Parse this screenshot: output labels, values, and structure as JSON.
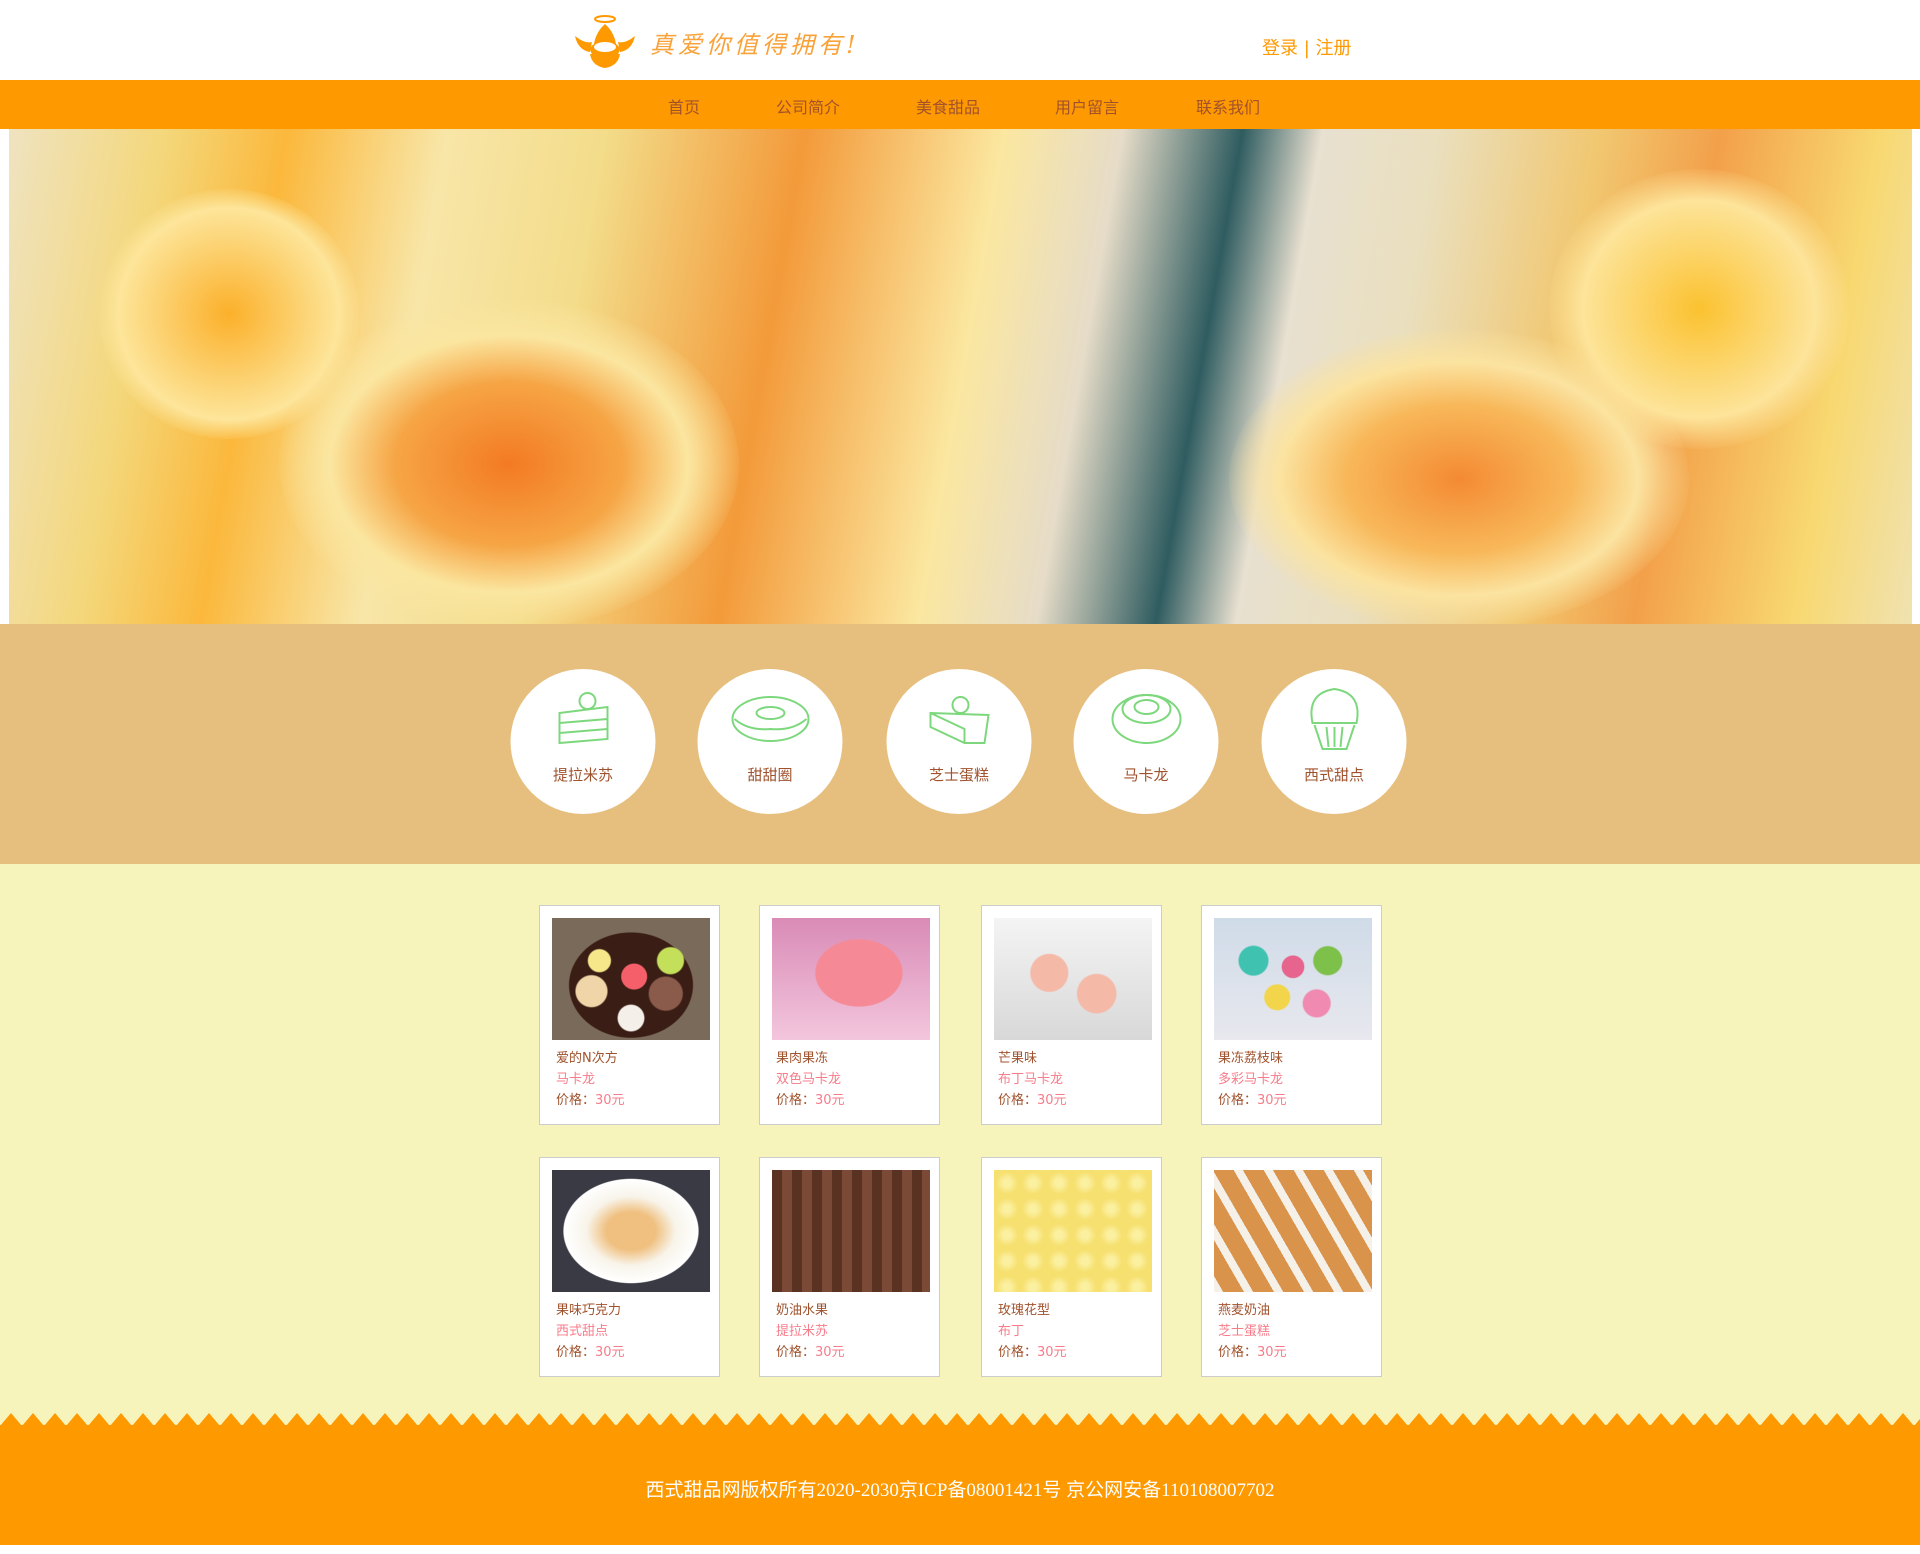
{
  "header": {
    "logo_text": "真爱你值得拥有!",
    "login": "登录",
    "separator": "|",
    "register": "注册"
  },
  "nav": [
    {
      "label": "首页"
    },
    {
      "label": "公司简介"
    },
    {
      "label": "美食甜品"
    },
    {
      "label": "用户留言"
    },
    {
      "label": "联系我们"
    }
  ],
  "categories": [
    {
      "label": "提拉米苏",
      "icon": "cake-slice-icon"
    },
    {
      "label": "甜甜圈",
      "icon": "donut-icon"
    },
    {
      "label": "芝士蛋糕",
      "icon": "cheesecake-icon"
    },
    {
      "label": "马卡龙",
      "icon": "macaron-icon"
    },
    {
      "label": "西式甜点",
      "icon": "cupcake-icon"
    }
  ],
  "price_label": "价格：",
  "products": [
    {
      "name": "爱的N次方",
      "category": "马卡龙",
      "price": "30元"
    },
    {
      "name": "果肉果冻",
      "category": "双色马卡龙",
      "price": "30元"
    },
    {
      "name": "芒果味",
      "category": "布丁马卡龙",
      "price": "30元"
    },
    {
      "name": "果冻荔枝味",
      "category": "多彩马卡龙",
      "price": "30元"
    },
    {
      "name": "果味巧克力",
      "category": "西式甜点",
      "price": "30元"
    },
    {
      "name": "奶油水果",
      "category": "提拉米苏",
      "price": "30元"
    },
    {
      "name": "玫瑰花型",
      "category": "布丁",
      "price": "30元"
    },
    {
      "name": "燕麦奶油",
      "category": "芝士蛋糕",
      "price": "30元"
    }
  ],
  "footer": {
    "text": "西式甜品网版权所有2020-2030京ICP备08001421号  京公网安备110108007702"
  },
  "colors": {
    "accent": "#ff9900",
    "category_bg": "#e6be7e",
    "products_bg": "#f7f4bb",
    "text_brown": "#a0522d",
    "price_pink": "#f77c8a",
    "icon_green": "#7dd87d"
  }
}
